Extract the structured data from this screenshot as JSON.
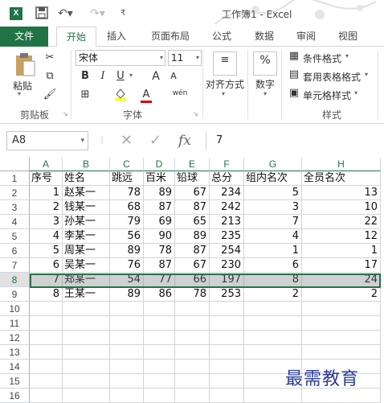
{
  "window": {
    "title": "工作簿1 - Excel"
  },
  "quick_access": {
    "save_icon": "save-icon",
    "undo_icon": "undo-icon",
    "redo_icon": "redo-icon"
  },
  "tabs": [
    "文件",
    "开始",
    "插入",
    "页面布局",
    "公式",
    "数据",
    "审阅",
    "视图"
  ],
  "active_tab": "开始",
  "ribbon": {
    "clipboard": {
      "paste_label": "粘贴",
      "group_label": "剪贴板"
    },
    "font": {
      "font_name": "宋体",
      "font_size": "11",
      "bold": "B",
      "italic": "I",
      "underline": "U",
      "grow": "A",
      "shrink": "A",
      "font_color": "A",
      "wen": "wén",
      "group_label": "字体"
    },
    "alignment": {
      "label": "对齐方式"
    },
    "number": {
      "symbol": "%",
      "label": "数字"
    },
    "styles": {
      "conditional": "条件格式",
      "table_format": "套用表格格式",
      "cell_styles": "单元格样式",
      "group_label": "样式"
    }
  },
  "formula_bar": {
    "name_box": "A8",
    "fx": "fx",
    "value": "7"
  },
  "sheet": {
    "columns": [
      "A",
      "B",
      "C",
      "D",
      "E",
      "F",
      "G",
      "H"
    ],
    "row_numbers": [
      "1",
      "2",
      "3",
      "4",
      "5",
      "6",
      "7",
      "8",
      "9",
      "10",
      "11",
      "12",
      "13",
      "14",
      "15",
      "16"
    ],
    "headers": [
      "序号",
      "姓名",
      "跳远",
      "百米",
      "铅球",
      "总分",
      "组内名次",
      "全员名次"
    ],
    "rows": [
      [
        "1",
        "赵某一",
        "78",
        "89",
        "67",
        "234",
        "5",
        "13"
      ],
      [
        "2",
        "钱某一",
        "68",
        "87",
        "87",
        "242",
        "3",
        "10"
      ],
      [
        "3",
        "孙某一",
        "79",
        "69",
        "65",
        "213",
        "7",
        "22"
      ],
      [
        "4",
        "李某一",
        "56",
        "90",
        "89",
        "235",
        "4",
        "12"
      ],
      [
        "5",
        "周某一",
        "89",
        "78",
        "87",
        "254",
        "1",
        "1"
      ],
      [
        "6",
        "吴某一",
        "76",
        "87",
        "67",
        "230",
        "6",
        "17"
      ],
      [
        "7",
        "郑某一",
        "54",
        "77",
        "66",
        "197",
        "8",
        "24"
      ],
      [
        "8",
        "王某一",
        "89",
        "86",
        "78",
        "253",
        "2",
        "2"
      ]
    ],
    "selected_row": "8"
  },
  "watermark": "最需教育",
  "colors": {
    "accent": "#217346",
    "watermark": "#2a3d99"
  }
}
